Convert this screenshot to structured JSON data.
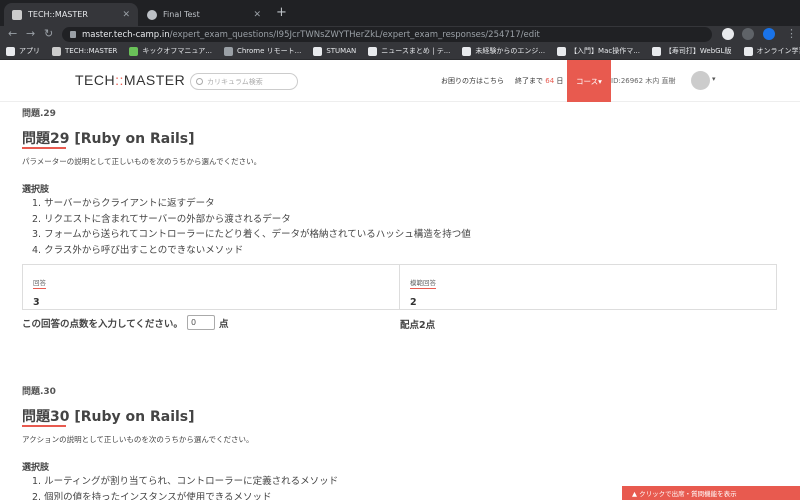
{
  "browser": {
    "tabs": [
      {
        "title": "TECH::MASTER",
        "active": true,
        "favicon_color": "#cccccc"
      },
      {
        "title": "Final Test",
        "active": false,
        "favicon_color": "#bdc1c6"
      }
    ],
    "url_host": "master.tech-camp.in",
    "url_path": "/expert_exam_questions/I95JcrTWNsZWYTHerZkL/expert_exam_responses/254717/edit",
    "bookmarks": [
      {
        "label": "アプリ",
        "color": "#e8eaed"
      },
      {
        "label": "TECH::MASTER",
        "color": "#cccccc"
      },
      {
        "label": "キックオフマニュア...",
        "color": "#6ac259"
      },
      {
        "label": "Chrome リモート...",
        "color": "#9aa0a6"
      },
      {
        "label": "STUMAN",
        "color": "#e8eaed"
      },
      {
        "label": "ニュースまとめ | テ...",
        "color": "#e8eaed"
      },
      {
        "label": "未経験からのエンジ...",
        "color": "#e8eaed"
      },
      {
        "label": "【入門】Mac操作マ...",
        "color": "#e8eaed"
      },
      {
        "label": "【寿司打】WebGL版",
        "color": "#e8eaed"
      },
      {
        "label": "オンライン学習の進...",
        "color": "#e8eaed"
      }
    ]
  },
  "header": {
    "logo_left": "TECH",
    "logo_sep": "::",
    "logo_right": "MASTER",
    "search_placeholder": "カリキュラム検索",
    "help": "お困りの方はこちら",
    "remain_prefix": "終了まで",
    "remain_days": "64",
    "remain_suffix": "日",
    "course": "コース▾",
    "user_id": "ID:26962 木内 直樹",
    "caret": "▾"
  },
  "questions": [
    {
      "number_label": "問題.29",
      "title_prefix": "問題",
      "title_num": "29",
      "title_rest": " [Ruby on Rails]",
      "description": "パラメーターの説明として正しいものを次のうちから選んでください。",
      "choices_label": "選択肢",
      "choices": [
        "サーバーからクライアントに返すデータ",
        "リクエストに含まれてサーバーの外部から渡されるデータ",
        "フォームから送られてコントローラーにたどり着く、データが格納されているハッシュ構造を持つ値",
        "クラス外から呼び出すことのできないメソッド"
      ],
      "answer_header": "回答",
      "answer_value": "3",
      "model_header": "模範回答",
      "model_value": "2",
      "score_prompt": "この回答の点数を入力してください。",
      "score_value": "0",
      "score_unit": "点",
      "points": "配点2点"
    },
    {
      "number_label": "問題.30",
      "title_prefix": "問題",
      "title_num": "30",
      "title_rest": " [Ruby on Rails]",
      "description": "アクションの説明として正しいものを次のうちから選んでください。",
      "choices_label": "選択肢",
      "choices": [
        "ルーティングが割り当てられ、コントローラーに定義されるメソッド",
        "個別の値を持ったインスタンスが使用できるメソッド"
      ]
    }
  ],
  "footer": {
    "label": "▲ クリックで出席・質問機能を表示"
  },
  "colors": {
    "accent": "#e85a4f",
    "chrome_dark": "#202124",
    "chrome_mid": "#35363a"
  }
}
